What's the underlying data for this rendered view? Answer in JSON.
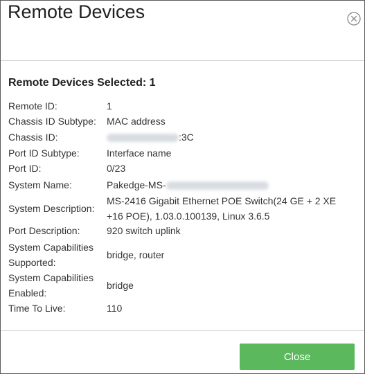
{
  "dialog": {
    "title": "Remote Devices",
    "close_icon": "close-circle-icon"
  },
  "summary": {
    "selected_label": "Remote Devices Selected: 1"
  },
  "fields": {
    "remote_id": {
      "label": "Remote ID:",
      "value": "1"
    },
    "chassis_id_subtype": {
      "label": "Chassis ID Subtype:",
      "value": "MAC address"
    },
    "chassis_id": {
      "label": "Chassis ID:",
      "value_visible_suffix": ":3C"
    },
    "port_id_subtype": {
      "label": "Port ID Subtype:",
      "value": "Interface name"
    },
    "port_id": {
      "label": "Port ID:",
      "value": "0/23"
    },
    "system_name": {
      "label": "System Name:",
      "value_visible_prefix": "Pakedge-MS-"
    },
    "system_description": {
      "label": "System Description:",
      "value_line1": "MS-2416 Gigabit Ethernet POE Switch(24 GE + 2 XE",
      "value_line2": "+16 POE), 1.03.0.100139, Linux 3.6.5"
    },
    "port_description": {
      "label": "Port Description:",
      "value": "920 switch uplink"
    },
    "system_capabilities_supported": {
      "label_line1": "System Capabilities",
      "label_line2": "Supported:",
      "value": "bridge, router"
    },
    "system_capabilities_enabled": {
      "label_line1": "System Capabilities",
      "label_line2": "Enabled:",
      "value": "bridge"
    },
    "time_to_live": {
      "label": "Time To Live:",
      "value": "110"
    }
  },
  "footer": {
    "close_button_label": "Close",
    "close_button_color": "#5cb85c"
  }
}
